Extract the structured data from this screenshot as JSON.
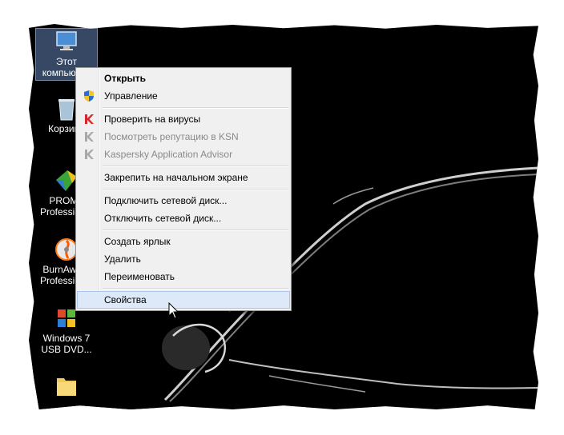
{
  "desktop": {
    "icons": [
      {
        "label": "Этот компьютер",
        "icon": "monitor-icon"
      },
      {
        "label": "Корзина",
        "icon": "recycle-bin-icon"
      },
      {
        "label": "PROMT Professional",
        "icon": "promt-icon"
      },
      {
        "label": "BurnAware Professional",
        "icon": "burnaware-icon"
      },
      {
        "label": "Windows 7 USB DVD...",
        "icon": "usb-dvd-tool-icon"
      },
      {
        "label": "",
        "icon": "folder-icon"
      }
    ]
  },
  "context_menu": {
    "items": [
      {
        "label": "Открыть",
        "bold": true
      },
      {
        "label": "Управление",
        "icon": "uac-shield-icon"
      },
      {
        "label": "Проверить на вирусы",
        "icon": "kaspersky-icon"
      },
      {
        "label": "Посмотреть репутацию в KSN",
        "icon": "kaspersky-icon",
        "disabled": true
      },
      {
        "label": "Kaspersky Application Advisor",
        "icon": "kaspersky-icon",
        "disabled": true
      },
      {
        "label": "Закрепить на начальном экране"
      },
      {
        "label": "Подключить сетевой диск..."
      },
      {
        "label": "Отключить сетевой диск..."
      },
      {
        "label": "Создать ярлык"
      },
      {
        "label": "Удалить"
      },
      {
        "label": "Переименовать"
      },
      {
        "label": "Свойства",
        "hovered": true
      }
    ]
  },
  "colors": {
    "desktop_bg": "#000000",
    "menu_bg": "#f0f0f0",
    "hover": "#dde8f8",
    "kaspersky_red": "#d6262b"
  }
}
